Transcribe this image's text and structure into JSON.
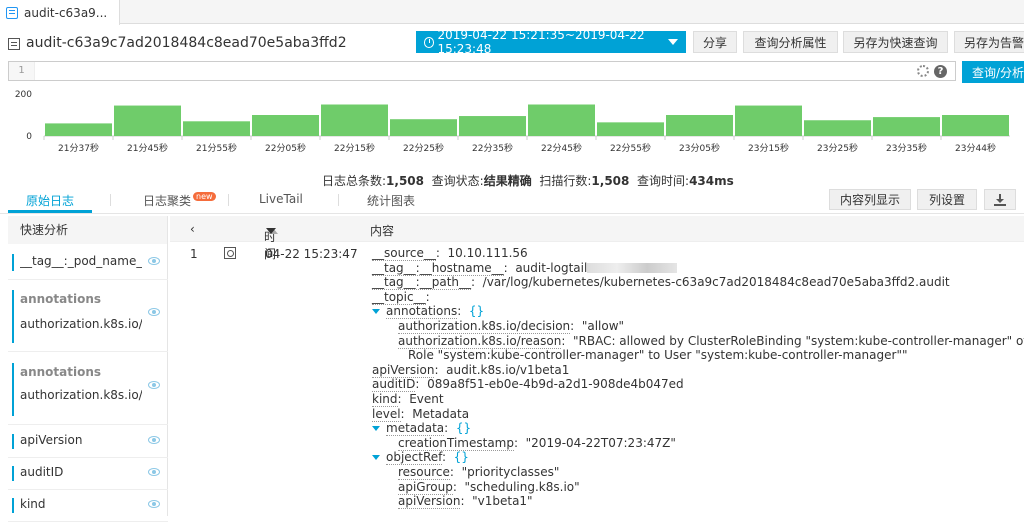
{
  "tab": {
    "label": "audit-c63a9..."
  },
  "header": {
    "title": "audit-c63a9c7ad2018484c8ead70e5aba3ffd2",
    "time_range": "2019-04-22 15:21:35~2019-04-22 15:23:48",
    "share": "分享",
    "query_props": "查询分析属性",
    "save_quick": "另存为快速查询",
    "save_alert": "另存为告警"
  },
  "query": {
    "line_no": "1",
    "submit": "查询/分析"
  },
  "chart_data": {
    "type": "bar",
    "categories": [
      "21分37秒",
      "21分45秒",
      "21分55秒",
      "22分05秒",
      "22分15秒",
      "22分25秒",
      "22分35秒",
      "22分45秒",
      "22分55秒",
      "23分05秒",
      "23分15秒",
      "23分25秒",
      "23分35秒",
      "23分44秒"
    ],
    "values": [
      60,
      145,
      70,
      100,
      150,
      80,
      95,
      150,
      65,
      100,
      145,
      75,
      90,
      100
    ],
    "ylim": [
      0,
      200
    ],
    "yticks": [
      "200",
      "0"
    ],
    "color": "#6fcc6a"
  },
  "status": {
    "total_label": "日志总条数:",
    "total": "1,508",
    "state_label": "查询状态:",
    "state": "结果精确",
    "scanned_label": "扫描行数:",
    "scanned": "1,508",
    "time_label": "查询时间:",
    "time": "434ms"
  },
  "subtabs": {
    "raw": "原始日志",
    "cluster": "日志聚类",
    "new": "new",
    "livetail": "LiveTail",
    "chart": "统计图表"
  },
  "toolbar": {
    "content_col": "内容列显示",
    "col_settings": "列设置"
  },
  "sidebar": {
    "title": "快速分析",
    "items": [
      {
        "label": "__tag__:_pod_name_"
      },
      {
        "group": "annotations",
        "label": "authorization.k8s.io/..."
      },
      {
        "group": "annotations",
        "label": "authorization.k8s.io/..."
      },
      {
        "label": "apiVersion"
      },
      {
        "label": "auditID"
      },
      {
        "label": "kind"
      }
    ]
  },
  "table": {
    "col_time": "时间",
    "col_content": "内容"
  },
  "row": {
    "num": "1",
    "time": "04-22 15:23:47",
    "fields": {
      "source_k": "__source__",
      "source_v": "10.10.111.56",
      "hostname_k": "__tag__:__hostname__",
      "hostname_v": "audit-logtail",
      "path_k": "__tag__:__path__",
      "path_v": "/var/log/kubernetes/kubernetes-c63a9c7ad2018484c8ead70e5aba3ffd2.audit",
      "topic_k": "__topic__",
      "annotations_k": "annotations",
      "decision_k": "authorization.k8s.io/decision",
      "decision_v": "\"allow\"",
      "reason_k": "authorization.k8s.io/reason",
      "reason_v1": "\"RBAC: allowed by ClusterRoleBinding \"system:kube-controller-manager\" of Cluster",
      "reason_v2": "Role \"system:kube-controller-manager\" to User \"system:kube-controller-manager\"\"",
      "apiversion_k": "apiVersion",
      "apiversion_v": "audit.k8s.io/v1beta1",
      "auditid_k": "auditID",
      "auditid_v": "089a8f51-eb0e-4b9d-a2d1-908de4b047ed",
      "kind_k": "kind",
      "kind_v": "Event",
      "level_k": "level",
      "level_v": "Metadata",
      "metadata_k": "metadata",
      "creation_k": "creationTimestamp",
      "creation_v": "\"2019-04-22T07:23:47Z\"",
      "objectref_k": "objectRef",
      "resource_k": "resource",
      "resource_v": "\"priorityclasses\"",
      "apigroup_k": "apiGroup",
      "apigroup_v": "\"scheduling.k8s.io\"",
      "apiver2_k": "apiVersion",
      "apiver2_v": "\"v1beta1\"",
      "brace": "{}"
    }
  }
}
